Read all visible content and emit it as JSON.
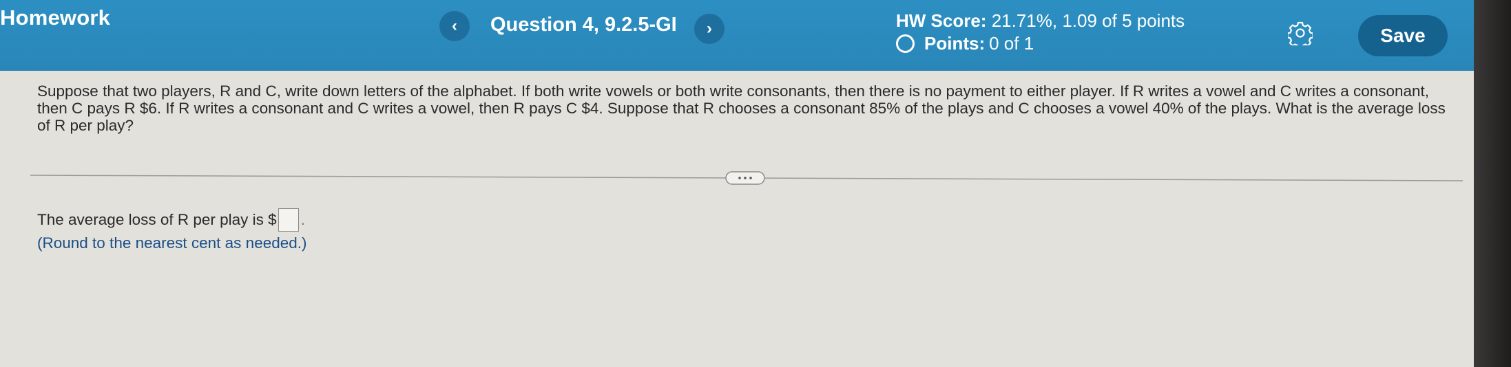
{
  "header": {
    "app_title": "Homework",
    "prev_glyph": "‹",
    "next_glyph": "›",
    "question_label": "Question 4, 9.2.5-GI",
    "hw_score_label": "HW Score:",
    "hw_score_value": "21.71%, 1.09 of 5 points",
    "points_label": "Points:",
    "points_value": "0 of 1",
    "save_label": "Save",
    "settings_icon": "gear-icon"
  },
  "question": {
    "text": "Suppose that two players, R and C, write down letters of the alphabet. If both write vowels or both write consonants, then there is no payment to either player. If R writes a vowel and C writes a consonant, then C pays R $6. If R writes a consonant and C writes a vowel, then R pays C $4. Suppose that R chooses a consonant 85% of the plays and C chooses a vowel 40% of the plays. What is the average loss of R per play?"
  },
  "answer": {
    "prompt": "The average loss of R per play is $",
    "value": "",
    "suffix": ".",
    "note": "(Round to the nearest cent as needed.)"
  },
  "colors": {
    "header_bg": "#2a88bb",
    "save_bg": "#16628f",
    "page_bg": "#e3e1dc",
    "note_text": "#1a4f86"
  }
}
